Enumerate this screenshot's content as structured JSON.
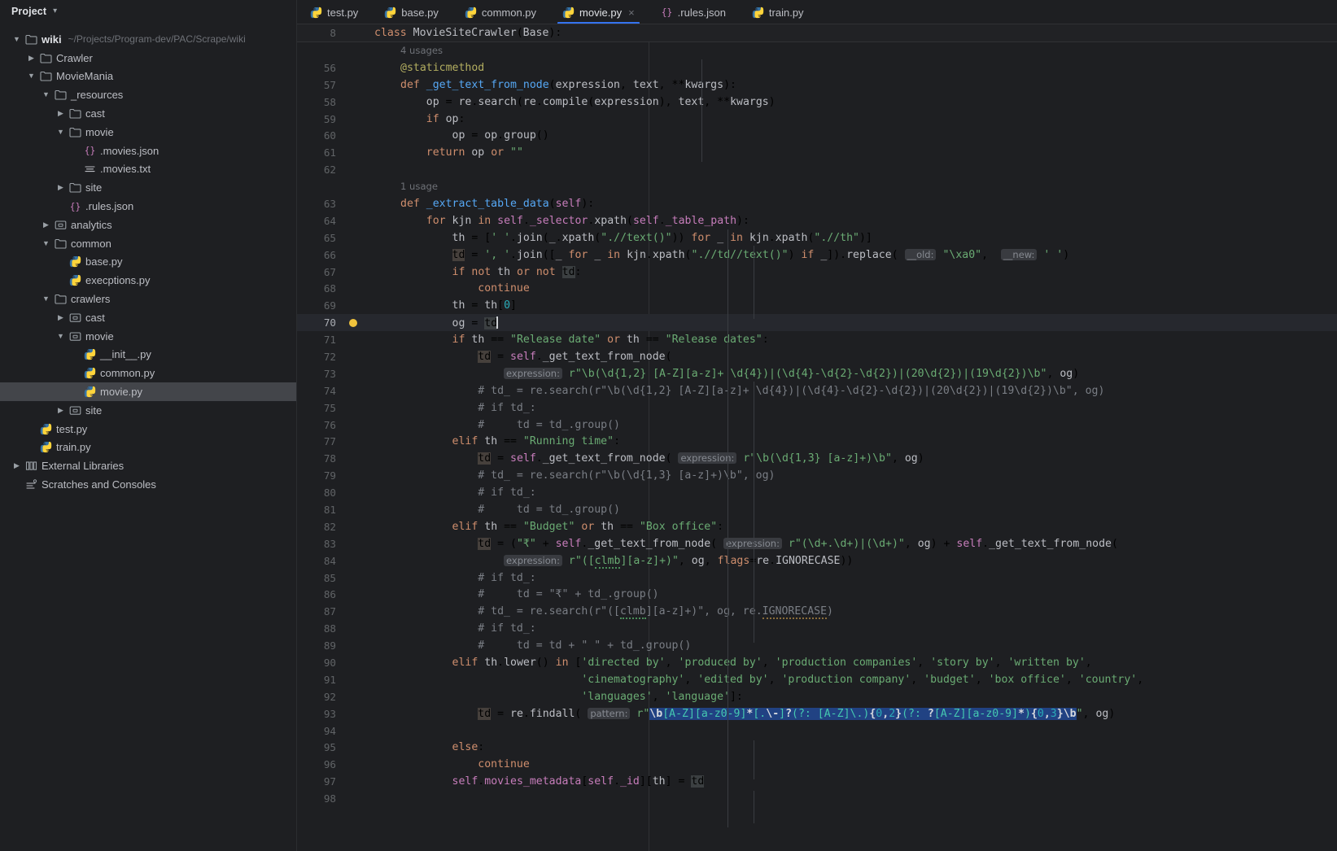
{
  "sidebar": {
    "title": "Project",
    "chevron": "chevron-down-icon",
    "items": [
      {
        "depth": 0,
        "arrow": "down",
        "icon": "folder",
        "label": "wiki",
        "bold": true,
        "path": "~/Projects/Program-dev/PAC/Scrape/wiki"
      },
      {
        "depth": 1,
        "arrow": "right",
        "icon": "folder",
        "label": "Crawler"
      },
      {
        "depth": 1,
        "arrow": "down",
        "icon": "folder",
        "label": "MovieMania"
      },
      {
        "depth": 2,
        "arrow": "down",
        "icon": "folder",
        "label": "_resources"
      },
      {
        "depth": 3,
        "arrow": "right",
        "icon": "folder",
        "label": "cast"
      },
      {
        "depth": 3,
        "arrow": "down",
        "icon": "folder",
        "label": "movie"
      },
      {
        "depth": 4,
        "arrow": "none",
        "icon": "json",
        "label": ".movies.json"
      },
      {
        "depth": 4,
        "arrow": "none",
        "icon": "text",
        "label": ".movies.txt"
      },
      {
        "depth": 3,
        "arrow": "right",
        "icon": "folder",
        "label": "site"
      },
      {
        "depth": 3,
        "arrow": "none",
        "icon": "json",
        "label": ".rules.json"
      },
      {
        "depth": 2,
        "arrow": "right",
        "icon": "package",
        "label": "analytics"
      },
      {
        "depth": 2,
        "arrow": "down",
        "icon": "folder",
        "label": "common"
      },
      {
        "depth": 3,
        "arrow": "none",
        "icon": "python",
        "label": "base.py"
      },
      {
        "depth": 3,
        "arrow": "none",
        "icon": "python",
        "label": "execptions.py"
      },
      {
        "depth": 2,
        "arrow": "down",
        "icon": "folder",
        "label": "crawlers"
      },
      {
        "depth": 3,
        "arrow": "right",
        "icon": "package",
        "label": "cast"
      },
      {
        "depth": 3,
        "arrow": "down",
        "icon": "package",
        "label": "movie"
      },
      {
        "depth": 4,
        "arrow": "none",
        "icon": "python",
        "label": "__init__.py"
      },
      {
        "depth": 4,
        "arrow": "none",
        "icon": "python",
        "label": "common.py"
      },
      {
        "depth": 4,
        "arrow": "none",
        "icon": "python",
        "label": "movie.py",
        "selected": true
      },
      {
        "depth": 3,
        "arrow": "right",
        "icon": "package",
        "label": "site"
      },
      {
        "depth": 1,
        "arrow": "none",
        "icon": "python",
        "label": "test.py"
      },
      {
        "depth": 1,
        "arrow": "none",
        "icon": "python",
        "label": "train.py"
      },
      {
        "depth": 0,
        "arrow": "right",
        "icon": "library",
        "label": "External Libraries"
      },
      {
        "depth": 0,
        "arrow": "none",
        "icon": "scratch",
        "label": "Scratches and Consoles"
      }
    ]
  },
  "tabs": [
    {
      "label": "test.py",
      "icon": "python",
      "active": false,
      "closable": false
    },
    {
      "label": "base.py",
      "icon": "python",
      "active": false,
      "closable": false
    },
    {
      "label": "common.py",
      "icon": "python",
      "active": false,
      "closable": false
    },
    {
      "label": "movie.py",
      "icon": "python",
      "active": true,
      "closable": true,
      "close": "×"
    },
    {
      "label": ".rules.json",
      "icon": "json",
      "active": false,
      "closable": false
    },
    {
      "label": "train.py",
      "icon": "python",
      "active": false,
      "closable": false
    }
  ],
  "editor": {
    "sticky_line_number": "8",
    "sticky_text": "class MovieSiteCrawler(Base):",
    "current_line": "70",
    "gutter_bulb_line": "70",
    "usage_hint_1": "4 usages",
    "usage_hint_2": "1 usage",
    "line_numbers": [
      "56",
      "57",
      "58",
      "59",
      "60",
      "61",
      "62",
      "63",
      "64",
      "65",
      "66",
      "67",
      "68",
      "69",
      "70",
      "71",
      "72",
      "73",
      "74",
      "75",
      "76",
      "77",
      "78",
      "79",
      "80",
      "81",
      "82",
      "83",
      "84",
      "85",
      "86",
      "87",
      "88",
      "89",
      "90",
      "91",
      "92",
      "93",
      "94",
      "95",
      "96",
      "97",
      "98"
    ],
    "inlay_hints": {
      "old": "__old:",
      "new": "__new:",
      "expression": "expression:",
      "pattern": "pattern:"
    },
    "code_lines": [
      "@staticmethod",
      "def _get_text_from_node(expression, text, **kwargs):",
      "    op = re.search(re.compile(expression), text, **kwargs)",
      "    if op:",
      "        op = op.group()",
      "    return op or \"\"",
      "",
      "def _extract_table_data(self):",
      "    for kjn in self._selector.xpath(self._table_path):",
      "        th = [' '.join(_.xpath(\".//text()\")) for _ in kjn.xpath(\".//th\")]",
      "        td = ', '.join([_ for _ in kjn.xpath(\".//td//text()\") if _]).replace( __old: \"\\xa0\",  __new: ' ')",
      "        if not th or not td:",
      "            continue",
      "        th = th[0]",
      "        og = td",
      "        if th == \"Release date\" or th == \"Release dates\":",
      "            td = self._get_text_from_node(",
      "                expression: r\"\\b(\\d{1,2} [A-Z][a-z]+ \\d{4})|(\\d{4}-\\d{2}-\\d{2})|(20\\d{2})|(19\\d{2})\\b\", og)",
      "            # td_ = re.search(r\"\\b(\\d{1,2} [A-Z][a-z]+ \\d{4})|(\\d{4}-\\d{2}-\\d{2})|(20\\d{2})|(19\\d{2})\\b\", og)",
      "            # if td_:",
      "            #     td = td_.group()",
      "        elif th == \"Running time\":",
      "            td = self._get_text_from_node( expression: r\"\\b(\\d{1,3} [a-z]+)\\b\", og)",
      "            # td_ = re.search(r\"\\b(\\d{1,3} [a-z]+)\\b\", og)",
      "            # if td_:",
      "            #     td = td_.group()",
      "        elif th == \"Budget\" or th == \"Box office\":",
      "            td = (\"₹\" + self._get_text_from_node( expression: r\"(\\d+.\\d+)|(\\d+)\", og) + self._get_text_from_node(",
      "                expression: r\"([clmb][a-z]+)\", og, flags=re.IGNORECASE))",
      "            # if td_:",
      "            #     td = \"₹\" + td_.group()",
      "            # td_ = re.search(r\"([clmb][a-z]+)\", og, re.IGNORECASE)",
      "            # if td_:",
      "            #     td = td + \" \" + td_.group()",
      "        elif th.lower() in ['directed by', 'produced by', 'production companies', 'story by', 'written by',",
      "                            'cinematography', 'edited by', 'production company', 'budget', 'box office', 'country',",
      "                            'languages', 'language']:",
      "            td = re.findall( pattern: r\"\\b[A-Z][a-z0-9]*[.\\-]?(?: [A-Z]\\.){0,2}(?: ?[A-Z][a-z0-9]*){0,3}\\b\", og)",
      "",
      "        else:",
      "            continue",
      "        self.movies_metadata[self._id][th] = td",
      ""
    ]
  }
}
